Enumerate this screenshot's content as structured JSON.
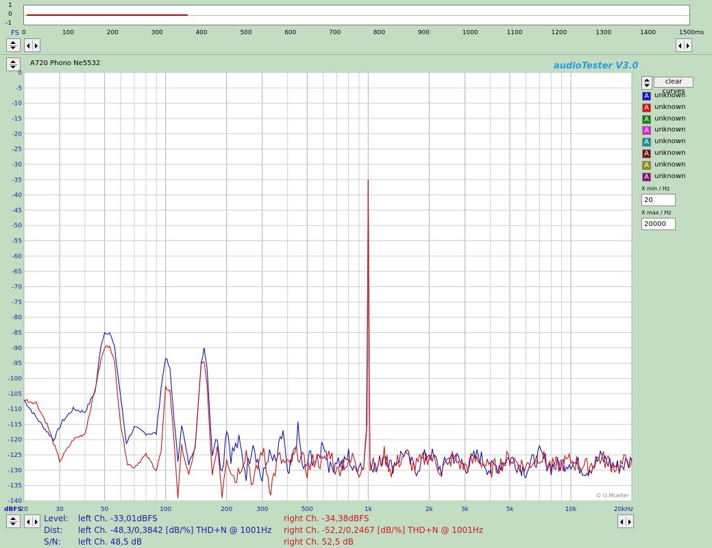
{
  "top_chart": {
    "fs_label": "FS",
    "y_ticks": [
      "1",
      "0",
      "-1"
    ],
    "x_ticks": [
      "0",
      "100",
      "200",
      "300",
      "400",
      "500",
      "600",
      "700",
      "800",
      "900",
      "1000",
      "1100",
      "1200",
      "1300",
      "1400",
      "1500ms"
    ],
    "trace_end_ms": 370,
    "trace_color": "#cc0000"
  },
  "header": {
    "file_title": "A720 Phono Ne5532",
    "app_title": "audioTester  V3.0"
  },
  "legend": {
    "clear_button": "clear curves",
    "items": [
      {
        "letter": "A",
        "label": "unknown",
        "color": "#1010cc"
      },
      {
        "letter": "A",
        "label": "unknown",
        "color": "#dd1010"
      },
      {
        "letter": "A",
        "label": "unknown",
        "color": "#108010"
      },
      {
        "letter": "A",
        "label": "unknown",
        "color": "#e020e0"
      },
      {
        "letter": "A",
        "label": "unknown",
        "color": "#10909a"
      },
      {
        "letter": "A",
        "label": "unknown",
        "color": "#801010"
      },
      {
        "letter": "A",
        "label": "unknown",
        "color": "#909010"
      },
      {
        "letter": "A",
        "label": "unknown",
        "color": "#801080"
      }
    ],
    "xmin_label": "X min / Hz",
    "xmin_value": "20",
    "xmax_label": "X max / Hz",
    "xmax_value": "20000"
  },
  "chart_data": {
    "type": "line",
    "x_scale": "log",
    "xlim": [
      20,
      20000
    ],
    "ylim": [
      -140,
      0
    ],
    "ylabel": "dBFS",
    "x_ticks": [
      {
        "v": 20,
        "t": "20"
      },
      {
        "v": 30,
        "t": "30"
      },
      {
        "v": 50,
        "t": "50"
      },
      {
        "v": 100,
        "t": "100"
      },
      {
        "v": 200,
        "t": "200"
      },
      {
        "v": 300,
        "t": "300"
      },
      {
        "v": 500,
        "t": "500"
      },
      {
        "v": 1000,
        "t": "1k"
      },
      {
        "v": 2000,
        "t": "2k"
      },
      {
        "v": 3000,
        "t": "3k"
      },
      {
        "v": 5000,
        "t": "5k"
      },
      {
        "v": 10000,
        "t": "10k"
      },
      {
        "v": 20000,
        "t": "20kHz"
      }
    ],
    "y_ticks": [
      0,
      -5,
      -10,
      -15,
      -20,
      -25,
      -30,
      -35,
      -40,
      -45,
      -50,
      -55,
      -60,
      -65,
      -70,
      -75,
      -80,
      -85,
      -90,
      -95,
      -100,
      -105,
      -110,
      -115,
      -120,
      -125,
      -130,
      -135,
      -140
    ],
    "watermark": "© U.Mueller",
    "series": [
      {
        "color": "#1010b0",
        "points": [
          [
            20,
            -107
          ],
          [
            22,
            -111
          ],
          [
            25,
            -116
          ],
          [
            28,
            -120
          ],
          [
            31,
            -114
          ],
          [
            35,
            -110
          ],
          [
            40,
            -111
          ],
          [
            45,
            -104
          ],
          [
            48,
            -89
          ],
          [
            50,
            -85
          ],
          [
            53,
            -85
          ],
          [
            56,
            -90
          ],
          [
            60,
            -106
          ],
          [
            64,
            -121
          ],
          [
            70,
            -116
          ],
          [
            80,
            -118
          ],
          [
            90,
            -118
          ],
          [
            95,
            -103
          ],
          [
            100,
            -93
          ],
          [
            105,
            -97
          ],
          [
            110,
            -113
          ],
          [
            115,
            -127
          ],
          [
            120,
            -115
          ],
          [
            130,
            -128
          ],
          [
            140,
            -122
          ],
          [
            150,
            -95
          ],
          [
            155,
            -90
          ],
          [
            160,
            -96
          ],
          [
            170,
            -125
          ],
          [
            180,
            -118
          ],
          [
            190,
            -131
          ],
          [
            200,
            -115
          ],
          [
            210,
            -125
          ],
          [
            230,
            -121
          ],
          [
            250,
            -131
          ],
          [
            270,
            -120
          ],
          [
            300,
            -134
          ],
          [
            320,
            -125
          ],
          [
            350,
            -128
          ],
          [
            380,
            -117
          ],
          [
            400,
            -133
          ],
          [
            420,
            -128
          ],
          [
            450,
            -117
          ],
          [
            480,
            -131
          ],
          [
            520,
            -125
          ],
          [
            560,
            -128
          ],
          [
            600,
            -120
          ],
          [
            650,
            -130
          ],
          [
            700,
            -126
          ],
          [
            750,
            -129
          ],
          [
            800,
            -125
          ],
          [
            850,
            -131
          ],
          [
            900,
            -127
          ],
          [
            950,
            -129
          ],
          [
            980,
            -118
          ],
          [
            995,
            -66
          ],
          [
            1000,
            -35
          ],
          [
            1005,
            -66
          ],
          [
            1020,
            -126
          ],
          [
            1100,
            -130
          ],
          [
            1200,
            -124
          ],
          [
            1300,
            -129
          ],
          [
            1500,
            -124
          ],
          [
            1700,
            -130
          ],
          [
            2000,
            -124
          ],
          [
            2300,
            -130
          ],
          [
            2600,
            -125
          ],
          [
            3000,
            -129
          ],
          [
            3500,
            -125
          ],
          [
            4000,
            -130
          ],
          [
            5000,
            -126
          ],
          [
            6000,
            -130
          ],
          [
            7000,
            -125
          ],
          [
            8000,
            -129
          ],
          [
            10000,
            -127
          ],
          [
            12000,
            -130
          ],
          [
            14000,
            -126
          ],
          [
            17000,
            -129
          ],
          [
            20000,
            -127
          ]
        ]
      },
      {
        "color": "#cc1010",
        "points": [
          [
            20,
            -107
          ],
          [
            23,
            -108
          ],
          [
            26,
            -115
          ],
          [
            30,
            -127
          ],
          [
            35,
            -120
          ],
          [
            40,
            -118
          ],
          [
            45,
            -103
          ],
          [
            48,
            -94
          ],
          [
            50,
            -90
          ],
          [
            53,
            -89
          ],
          [
            56,
            -95
          ],
          [
            60,
            -115
          ],
          [
            65,
            -128
          ],
          [
            70,
            -129
          ],
          [
            80,
            -125
          ],
          [
            90,
            -130
          ],
          [
            95,
            -124
          ],
          [
            100,
            -103
          ],
          [
            105,
            -104
          ],
          [
            110,
            -120
          ],
          [
            115,
            -139
          ],
          [
            120,
            -122
          ],
          [
            130,
            -132
          ],
          [
            140,
            -122
          ],
          [
            150,
            -95
          ],
          [
            155,
            -95
          ],
          [
            160,
            -102
          ],
          [
            170,
            -132
          ],
          [
            180,
            -122
          ],
          [
            190,
            -137
          ],
          [
            200,
            -125
          ],
          [
            220,
            -133
          ],
          [
            250,
            -124
          ],
          [
            270,
            -135
          ],
          [
            300,
            -123
          ],
          [
            330,
            -136
          ],
          [
            360,
            -126
          ],
          [
            400,
            -129
          ],
          [
            450,
            -124
          ],
          [
            500,
            -130
          ],
          [
            550,
            -126
          ],
          [
            600,
            -128
          ],
          [
            650,
            -124
          ],
          [
            700,
            -131
          ],
          [
            750,
            -127
          ],
          [
            800,
            -129
          ],
          [
            850,
            -125
          ],
          [
            900,
            -130
          ],
          [
            950,
            -128
          ],
          [
            985,
            -115
          ],
          [
            995,
            -67
          ],
          [
            1000,
            -35
          ],
          [
            1005,
            -67
          ],
          [
            1020,
            -127
          ],
          [
            1100,
            -130
          ],
          [
            1200,
            -125
          ],
          [
            1300,
            -130
          ],
          [
            1500,
            -125
          ],
          [
            1700,
            -129
          ],
          [
            2000,
            -125
          ],
          [
            2300,
            -130
          ],
          [
            2600,
            -126
          ],
          [
            3000,
            -129
          ],
          [
            3500,
            -126
          ],
          [
            4000,
            -130
          ],
          [
            5000,
            -126
          ],
          [
            6000,
            -129
          ],
          [
            7000,
            -125
          ],
          [
            8000,
            -129
          ],
          [
            10000,
            -127
          ],
          [
            12000,
            -129
          ],
          [
            14000,
            -126
          ],
          [
            17000,
            -129
          ],
          [
            20000,
            -126
          ]
        ]
      }
    ]
  },
  "status": {
    "level_label": "Level:",
    "dist_label": "Dist:",
    "sn_label": "S/N:",
    "left_level": "left Ch. -33,01dBFS",
    "left_dist": "left Ch. -48,3/0,3842 [dB/%] THD+N  @ 1001Hz",
    "left_sn": "left Ch. 48,5 dB",
    "right_level": "right Ch. -34,38dBFS",
    "right_dist": "right Ch. -52,2/0,2467 [dB/%] THD+N  @ 1001Hz",
    "right_sn": "right Ch. 52,5 dB",
    "left_color": "#1a1aa8",
    "right_color": "#d01818"
  }
}
